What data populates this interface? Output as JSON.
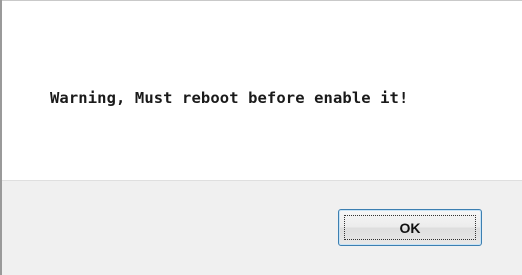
{
  "dialog": {
    "message": "Warning, Must reboot before enable it!",
    "ok_label": "OK"
  }
}
